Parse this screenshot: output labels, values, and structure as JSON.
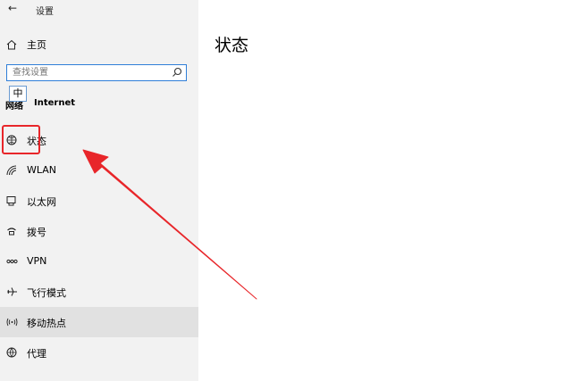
{
  "window": {
    "title": "设置"
  },
  "sidebar": {
    "home_label": "主页",
    "search": {
      "placeholder": "查找设置"
    },
    "ime_label": "中",
    "section_prefix": "网络",
    "section_title": "Internet",
    "items": [
      {
        "label": "状态",
        "icon": "globe-icon"
      },
      {
        "label": "WLAN",
        "icon": "wifi-icon"
      },
      {
        "label": "以太网",
        "icon": "ethernet-icon"
      },
      {
        "label": "拨号",
        "icon": "dialup-icon"
      },
      {
        "label": "VPN",
        "icon": "vpn-icon"
      },
      {
        "label": "飞行模式",
        "icon": "airplane-icon"
      },
      {
        "label": "移动热点",
        "icon": "hotspot-icon"
      },
      {
        "label": "代理",
        "icon": "proxy-icon"
      }
    ]
  },
  "main": {
    "page_title": "状态"
  },
  "colors": {
    "accent": "#2f7ed8",
    "annotation": "#e8262a",
    "sidebar_bg": "#f2f2f2",
    "selected_bg": "#e1e1e1"
  }
}
